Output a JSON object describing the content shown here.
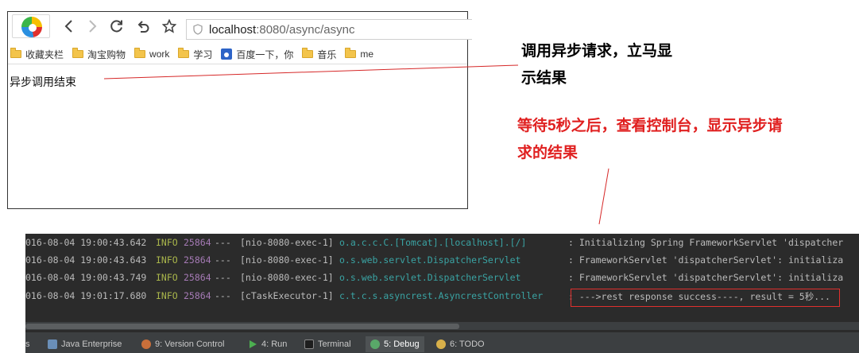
{
  "browser": {
    "url_host": "localhost",
    "url_path": ":8080/async/async",
    "bookmarks": [
      "收藏夹栏",
      "淘宝购物",
      "work",
      "学习",
      "百度一下，你",
      "音乐",
      "me"
    ],
    "page_text": "异步调用结束"
  },
  "annotations": {
    "note_1": "调用异步请求，立马显示结果",
    "note_2": "等待5秒之后，查看控制台，显示异步请求的结果"
  },
  "console": {
    "lines": [
      {
        "timestamp": "016-08-04 19:00:43.642",
        "level": "INFO",
        "pid": "25864",
        "sep": "---",
        "thread": "[nio-8080-exec-1]",
        "logger": "o.a.c.c.C.[Tomcat].[localhost].[/]",
        "message": ": Initializing Spring FrameworkServlet 'dispatcher"
      },
      {
        "timestamp": "016-08-04 19:00:43.643",
        "level": "INFO",
        "pid": "25864",
        "sep": "---",
        "thread": "[nio-8080-exec-1]",
        "logger": "o.s.web.servlet.DispatcherServlet",
        "message": ": FrameworkServlet 'dispatcherServlet': initializa"
      },
      {
        "timestamp": "016-08-04 19:00:43.749",
        "level": "INFO",
        "pid": "25864",
        "sep": "---",
        "thread": "[nio-8080-exec-1]",
        "logger": "o.s.web.servlet.DispatcherServlet",
        "message": ": FrameworkServlet 'dispatcherServlet': initializa"
      },
      {
        "timestamp": "016-08-04 19:01:17.680",
        "level": "INFO",
        "pid": "25864",
        "sep": "---",
        "thread": "[cTaskExecutor-1]",
        "logger": "c.t.c.s.asyncrest.AsyncrestController",
        "message": ": --->rest response success----, result = 5秒..."
      }
    ],
    "tabs": [
      "s",
      "Java Enterprise",
      "9: Version Control",
      "4: Run",
      "Terminal",
      "5: Debug",
      "6: TODO"
    ]
  },
  "colors": {
    "annotation_red": "#e02020",
    "console_bg": "#2b2b2b",
    "info_green": "#a9b64b",
    "pid_purple": "#a57ab5",
    "logger_teal": "#3aa3a3"
  }
}
